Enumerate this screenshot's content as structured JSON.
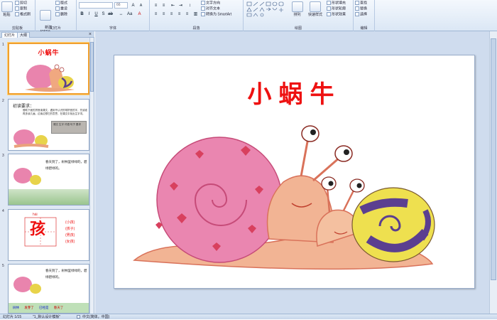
{
  "ribbon": {
    "clipboard": {
      "paste": "粘贴",
      "cut": "剪切",
      "copy": "复制",
      "format": "格式刷",
      "group": "剪贴板"
    },
    "slides": {
      "new": "新建\n幻灯片",
      "layout": "版式",
      "reset": "重设",
      "delete": "删除",
      "group": "幻灯片"
    },
    "font": {
      "size": "66",
      "group": "字体"
    },
    "paragraph": {
      "dir": "文字方向",
      "align": "对齐文本",
      "smartart": "转换为 SmartArt",
      "group": "段落"
    },
    "drawing": {
      "arrange": "排列",
      "styles": "快速样式",
      "fill": "形状填充",
      "outline": "形状轮廓",
      "effects": "形状效果",
      "group": "绘图"
    },
    "editing": {
      "find": "查找",
      "replace": "替换",
      "select": "选择",
      "group": "编辑"
    }
  },
  "panel": {
    "tab_slides": "幻灯片",
    "tab_outline": "大纲",
    "close": "×"
  },
  "thumbs": [
    {
      "num": "1",
      "title": "小蜗牛"
    },
    {
      "num": "2",
      "title": "初读要求：",
      "text": "借助下面的拼音读课文，遇到不认识的带拼音的字，先读准再多读几遍，边读边想它的意思，在课文中找出生字词。",
      "box": "课文 生字 词语 句子 要求"
    },
    {
      "num": "3",
      "text": "春天到了，树林里绿绿的，碧绿碧绿的。"
    },
    {
      "num": "4",
      "pinyin": "hái",
      "char": "孩",
      "words": [
        "(小孩)",
        "(孩子)",
        "(男孩)",
        "(女孩)"
      ]
    },
    {
      "num": "5",
      "text": "春天到了，树林里绿绿的，碧绿碧绿的。",
      "bar": [
        "树林",
        "发芽了",
        "已经是",
        "春天了"
      ]
    }
  ],
  "slide": {
    "title": "小蜗牛"
  },
  "status": {
    "slide": "幻灯片 1/15",
    "theme": "\"1_默认设计模板\"",
    "lang": "中文(简体，中国)"
  }
}
